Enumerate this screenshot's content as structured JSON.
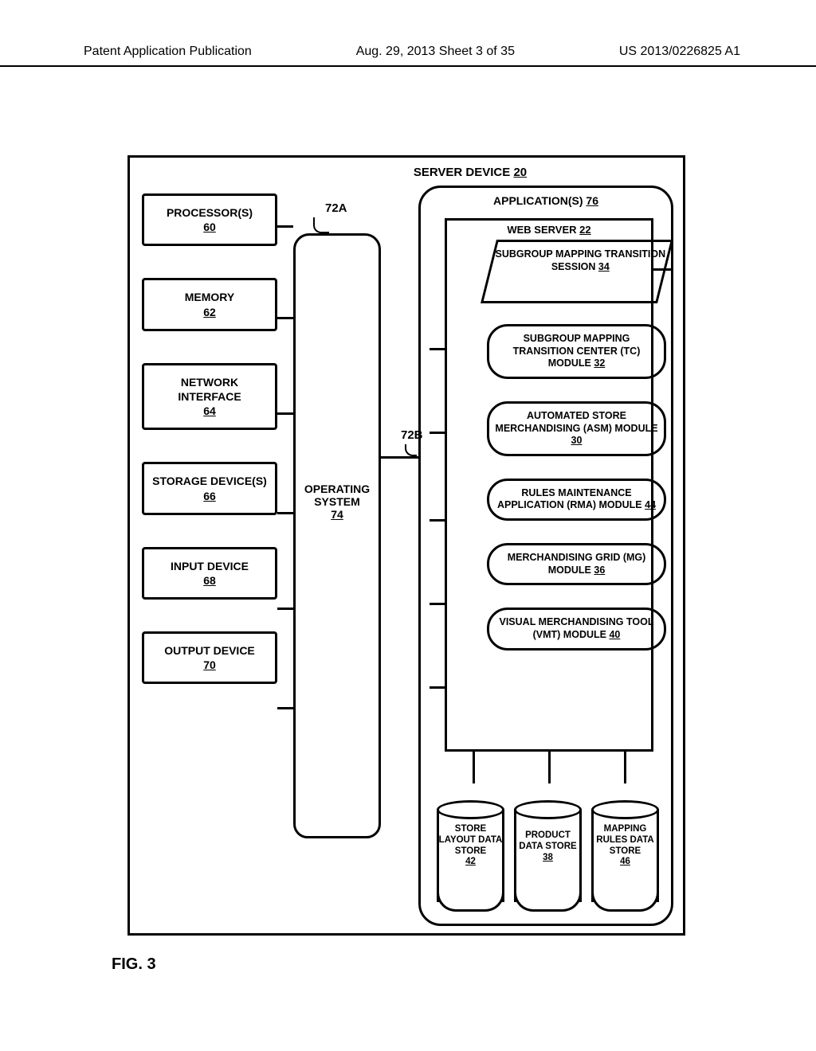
{
  "header": {
    "left": "Patent Application Publication",
    "center": "Aug. 29, 2013  Sheet 3 of 35",
    "right": "US 2013/0226825 A1"
  },
  "figure_label": "FIG. 3",
  "server": {
    "title": "SERVER DEVICE",
    "ref": "20"
  },
  "left_boxes": [
    {
      "label": "PROCESSOR(S)",
      "ref": "60"
    },
    {
      "label": "MEMORY",
      "ref": "62"
    },
    {
      "label": "NETWORK INTERFACE",
      "ref": "64"
    },
    {
      "label": "STORAGE DEVICE(S)",
      "ref": "66"
    },
    {
      "label": "INPUT DEVICE",
      "ref": "68"
    },
    {
      "label": "OUTPUT DEVICE",
      "ref": "70"
    }
  ],
  "os": {
    "label": "OPERATING SYSTEM",
    "ref": "74"
  },
  "bus_labels": {
    "a": "72A",
    "b": "72B"
  },
  "apps": {
    "title": "APPLICATION(S)",
    "ref": "76"
  },
  "webserver": {
    "title": "WEB SERVER",
    "ref": "22"
  },
  "session": {
    "label": "SUBGROUP MAPPING TRANSITION SESSION",
    "ref": "34"
  },
  "modules": [
    {
      "label": "SUBGROUP MAPPING TRANSITION CENTER (TC) MODULE",
      "ref": "32"
    },
    {
      "label": "AUTOMATED STORE MERCHANDISING (ASM) MODULE",
      "ref": "30"
    },
    {
      "label": "RULES MAINTENANCE APPLICATION (RMA) MODULE",
      "ref": "44"
    },
    {
      "label": "MERCHANDISING GRID (MG) MODULE",
      "ref": "36"
    },
    {
      "label": "VISUAL MERCHANDISING TOOL (VMT) MODULE",
      "ref": "40"
    }
  ],
  "datastores": [
    {
      "label": "STORE LAYOUT DATA STORE",
      "ref": "42"
    },
    {
      "label": "PRODUCT DATA STORE",
      "ref": "38"
    },
    {
      "label": "MAPPING RULES DATA STORE",
      "ref": "46"
    }
  ]
}
